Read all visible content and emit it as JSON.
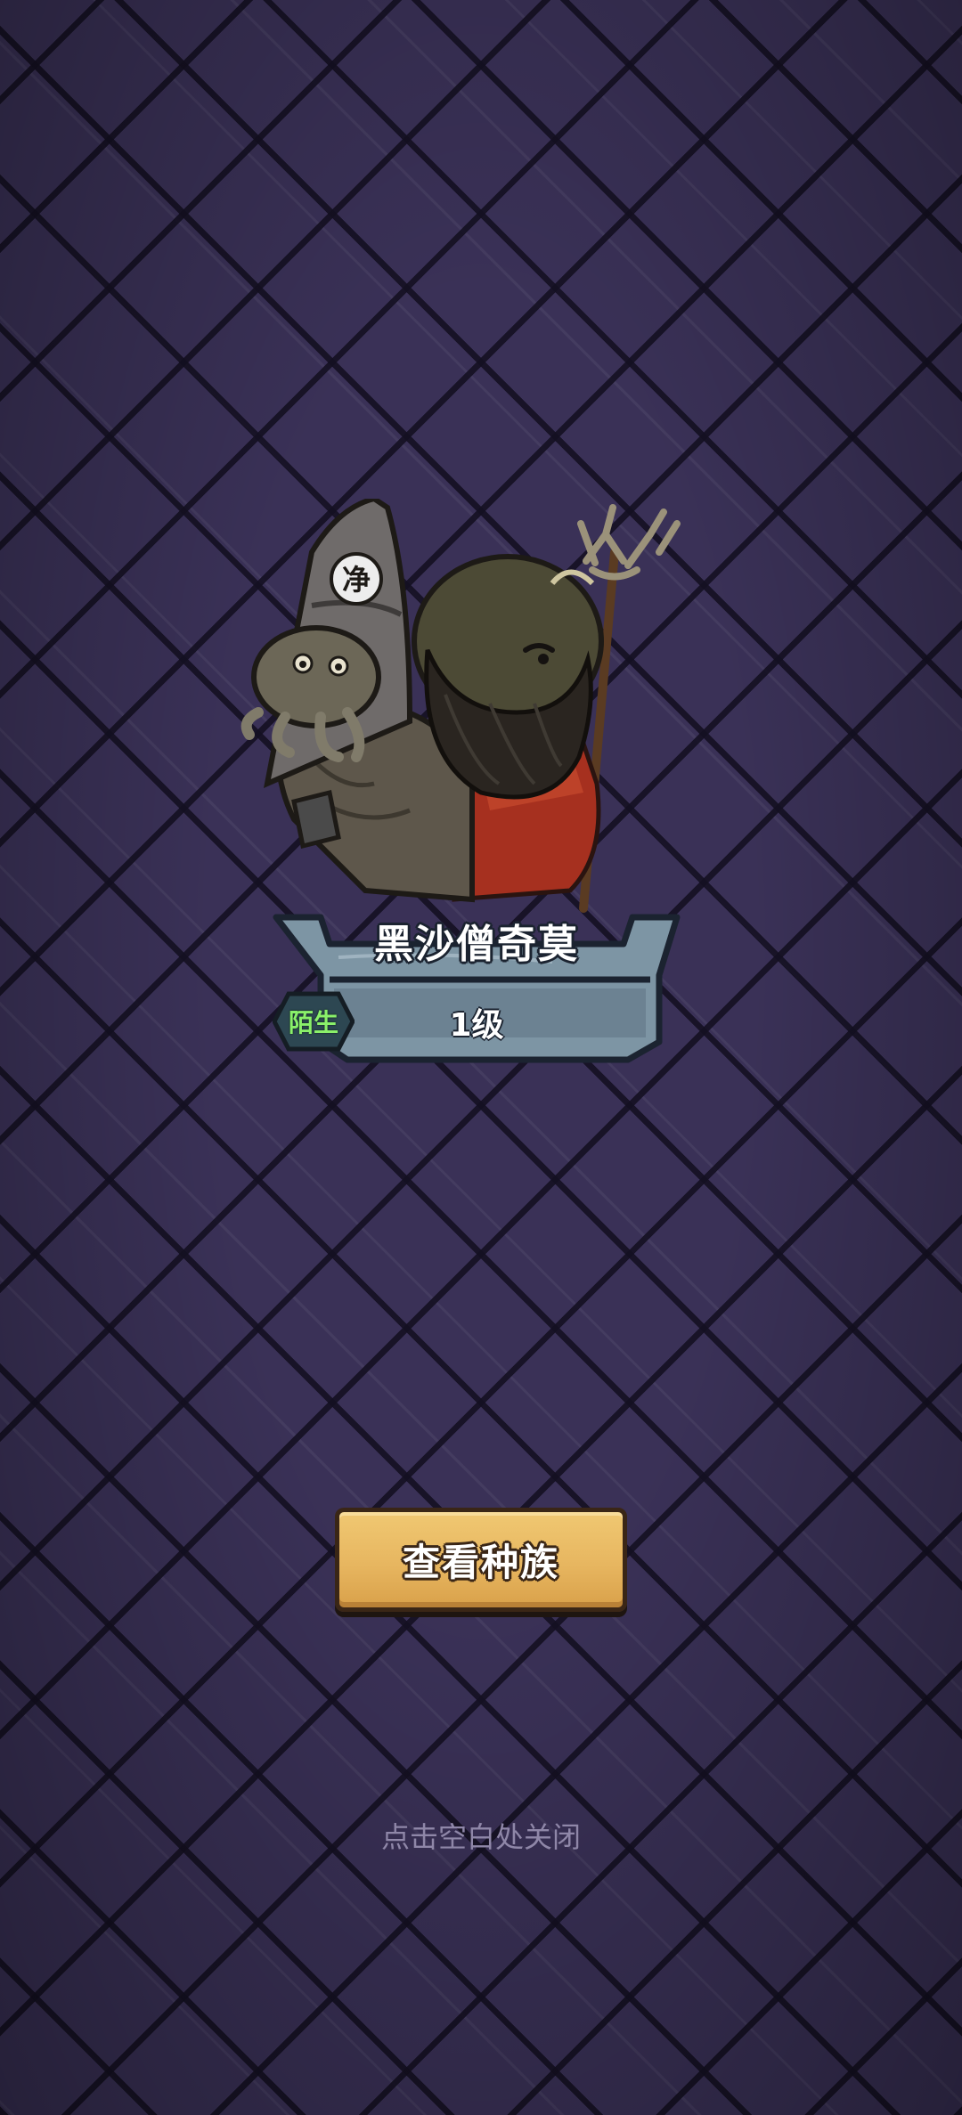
{
  "creature": {
    "name": "黑沙僧奇莫",
    "status": "陌生",
    "level": "1级",
    "hat_glyph": "净"
  },
  "actions": {
    "view_race_label": "查看种族"
  },
  "hint": {
    "close_text": "点击空白处关闭"
  },
  "colors": {
    "background": "#3a3157",
    "button": "#e7b660",
    "plate": "#7d95a4",
    "status_text": "#8af06a"
  }
}
